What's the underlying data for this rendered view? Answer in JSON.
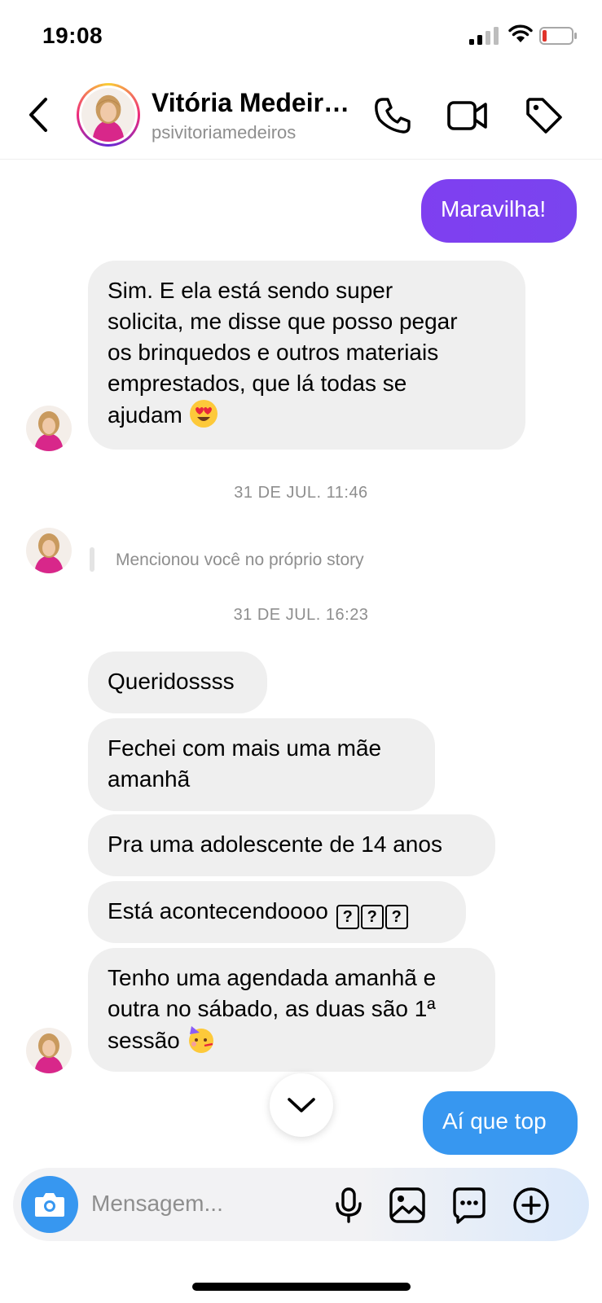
{
  "status_bar": {
    "time": "19:08"
  },
  "header": {
    "name": "Vitória Medeir…",
    "username": "psivitoriamedeiros"
  },
  "messages": {
    "out_1": "Maravilha!",
    "in_1_lines": [
      "Sim. E ela está sendo super",
      "solicita, me disse que posso pegar",
      "os brinquedos e outros materiais",
      "emprestados, que lá todas se",
      "ajudam"
    ],
    "ts_1": "31 DE JUL. 11:46",
    "mention": "Mencionou você no próprio story",
    "ts_2": "31 DE JUL. 16:23",
    "in_2": "Queridossss",
    "in_3_lines": [
      "Fechei com mais uma mãe",
      "amanhã"
    ],
    "in_4": "Pra uma adolescente de 14 anos",
    "in_5": "Está acontecendoooo",
    "in_5_boxes": [
      "?",
      "?",
      "?"
    ],
    "in_6_lines": [
      "Tenho uma agendada amanhã e",
      "outra no sábado, as duas são 1ª",
      "sessão"
    ],
    "out_2": "Aí que top"
  },
  "composer": {
    "placeholder": "Mensagem..."
  },
  "colors": {
    "out_bubble_purple": "#7b3fee",
    "out_bubble_blue": "#3797f0",
    "in_bubble": "#efefef",
    "accent": "#3797f0"
  },
  "icons": [
    "back-icon",
    "phone-icon",
    "video-icon",
    "tag-icon",
    "chevron-down-icon",
    "camera-icon",
    "microphone-icon",
    "image-icon",
    "sticker-icon",
    "plus-icon"
  ]
}
